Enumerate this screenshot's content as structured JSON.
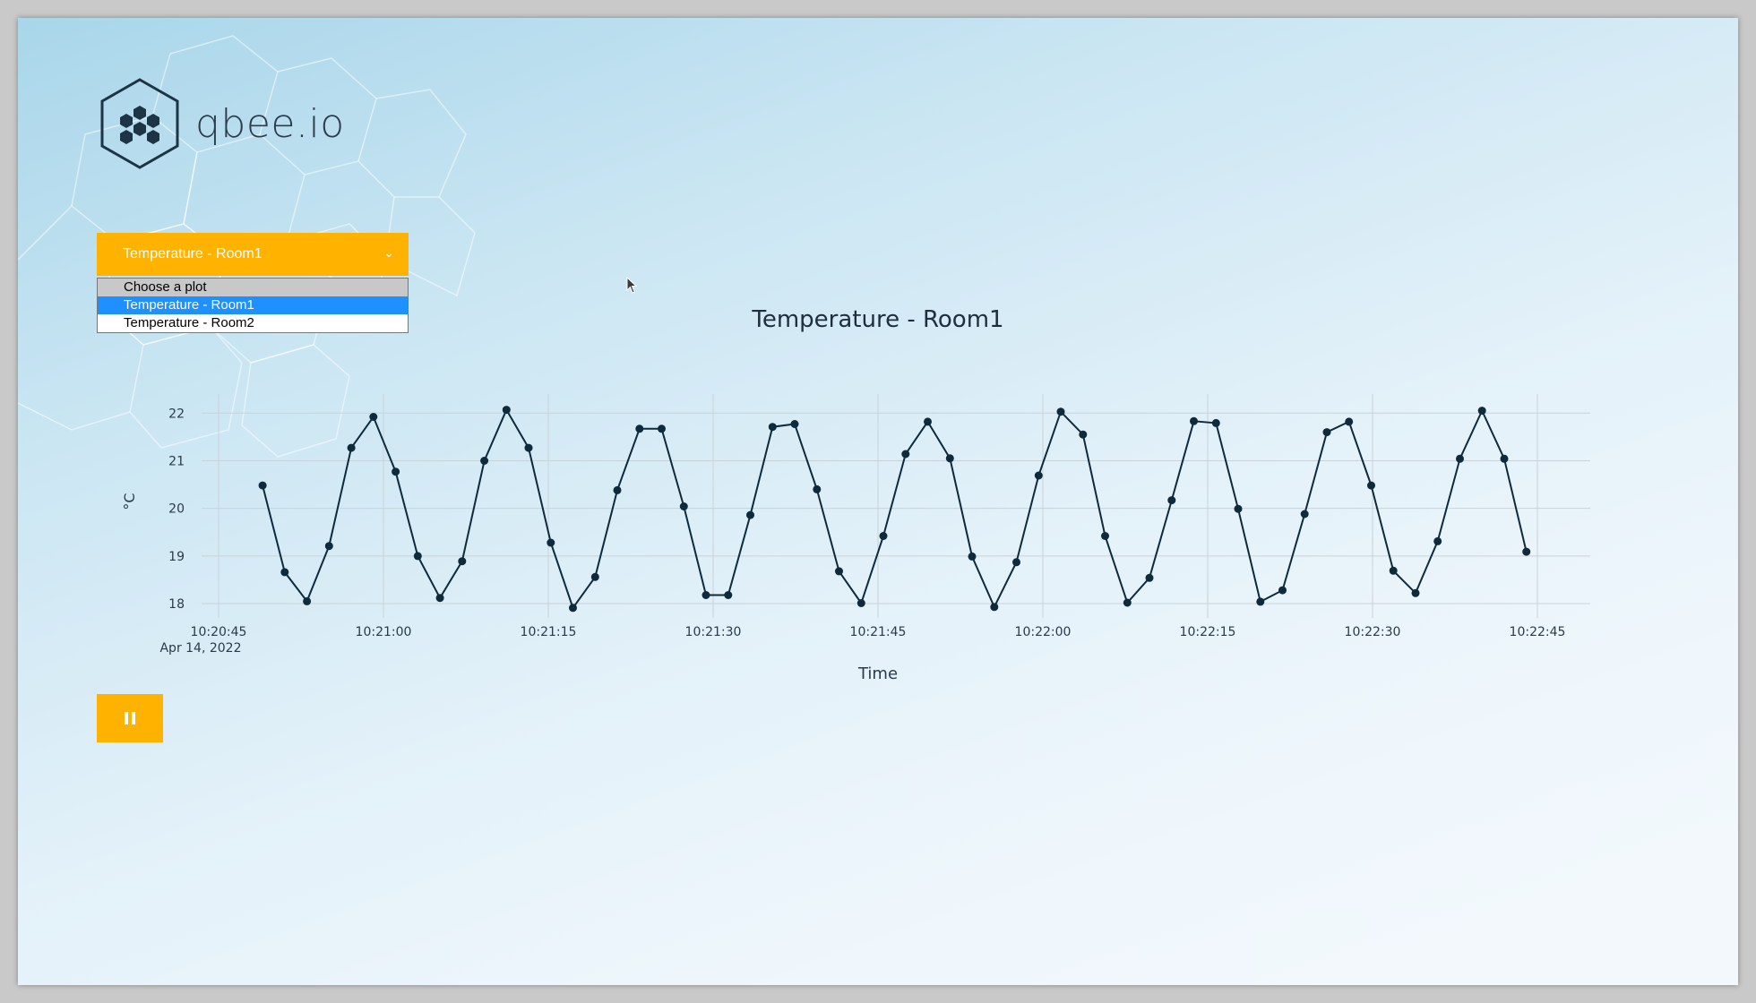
{
  "brand": {
    "name": "qbee.io"
  },
  "selector": {
    "current": "Temperature - Room1",
    "options": [
      "Choose a plot",
      "Temperature - Room1",
      "Temperature - Room2"
    ]
  },
  "colors": {
    "accent": "#ffb300",
    "line": "#0e2a3b",
    "selected_option": "#1e90ff"
  },
  "icons": {
    "pause": "pause-icon",
    "chevron": "chevron-down-icon"
  },
  "chart_data": {
    "type": "line",
    "title": "Temperature - Room1",
    "xlabel": "Time",
    "ylabel": "°C",
    "ylim": [
      17.7,
      22.4
    ],
    "yticks": [
      18,
      19,
      20,
      21,
      22
    ],
    "xticks": [
      "10:20:45",
      "10:21:00",
      "10:21:15",
      "10:21:30",
      "10:21:45",
      "10:22:00",
      "10:22:15",
      "10:22:30",
      "10:22:45"
    ],
    "date_label": "Apr 14, 2022",
    "grid": true,
    "x_start": "10:20:49",
    "x_end": "10:22:44",
    "series": [
      {
        "values": [
          20.48,
          18.66,
          18.05,
          19.21,
          21.27,
          21.92,
          20.77,
          19.0,
          18.12,
          18.89,
          21.0,
          22.07,
          21.27,
          19.28,
          17.91,
          18.56,
          20.38,
          21.67,
          21.67,
          20.04,
          18.18,
          18.18,
          19.86,
          21.71,
          21.77,
          20.4,
          18.68,
          18.01,
          19.42,
          21.14,
          21.82,
          21.05,
          18.99,
          17.93,
          18.87,
          20.69,
          22.03,
          21.55,
          19.42,
          18.02,
          18.54,
          20.17,
          21.83,
          21.79,
          19.99,
          18.04,
          18.28,
          19.88,
          21.6,
          21.82,
          20.48,
          18.69,
          18.22,
          19.31,
          21.04,
          22.05,
          21.04,
          19.09
        ]
      }
    ]
  }
}
